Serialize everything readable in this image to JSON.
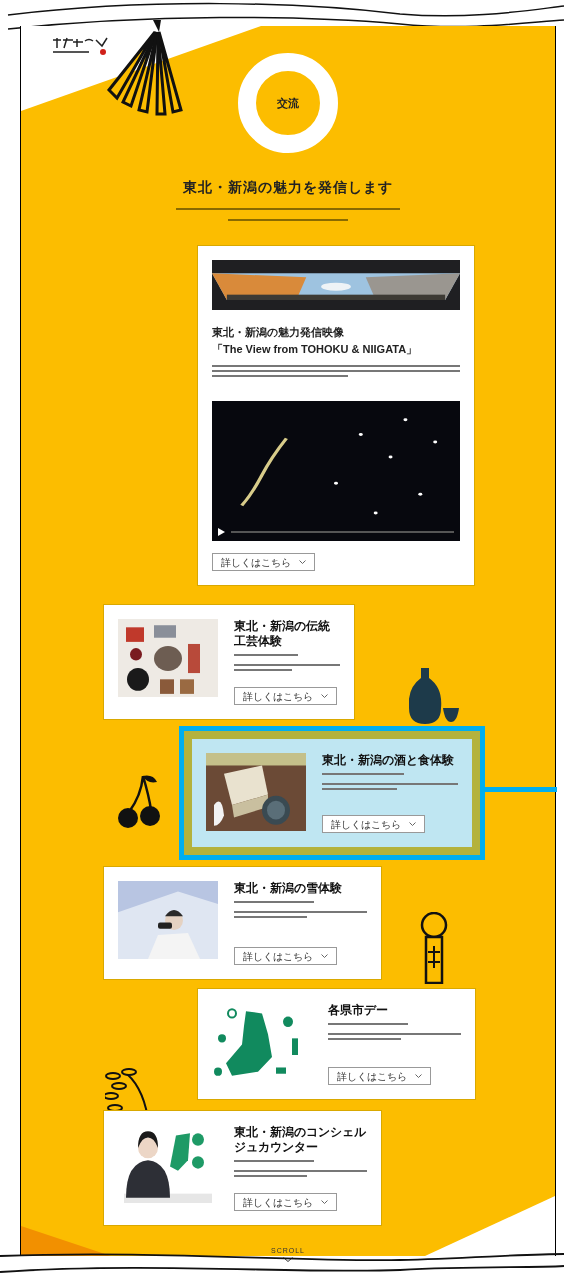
{
  "section": {
    "badge": "交流",
    "heading": "東北・新潟の魅力を発信します"
  },
  "cards": [
    {
      "kind": "feature",
      "title_lines": [
        "東北・新潟の魅力発信映像",
        "「The View from TOHOKU & NIIGATA」"
      ],
      "button": "詳しくはこちら",
      "highlighted": false
    },
    {
      "kind": "side",
      "title": "東北・新潟の伝統工芸体験",
      "button": "詳しくはこちら",
      "highlighted": false
    },
    {
      "kind": "side",
      "title": "東北・新潟の酒と食体験",
      "button": "詳しくはこちら",
      "highlighted": true
    },
    {
      "kind": "side",
      "title": "東北・新潟の雪体験",
      "button": "詳しくはこちら",
      "highlighted": false
    },
    {
      "kind": "side",
      "title": "各県市デー",
      "button": "詳しくはこちら",
      "highlighted": false
    },
    {
      "kind": "side",
      "title": "東北・新潟のコンシェルジュカウンター",
      "button": "詳しくはこちら",
      "highlighted": false
    }
  ],
  "scroll_label": "SCROLL"
}
